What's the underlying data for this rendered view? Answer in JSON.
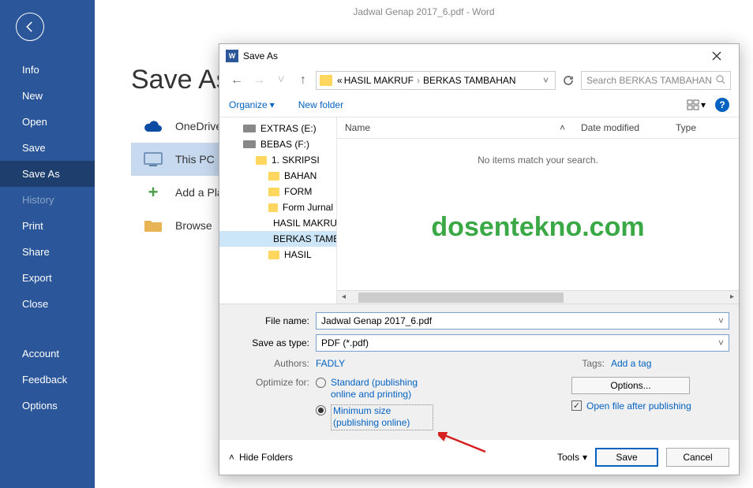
{
  "app": {
    "title": "Jadwal Genap 2017_6.pdf  -  Word"
  },
  "page": {
    "title": "Save As"
  },
  "sidebar": {
    "items": [
      "Info",
      "New",
      "Open",
      "Save",
      "Save As",
      "History",
      "Print",
      "Share",
      "Export",
      "Close"
    ],
    "bottom": [
      "Account",
      "Feedback",
      "Options"
    ]
  },
  "locations": {
    "items": [
      "OneDrive",
      "This PC",
      "Add a Place",
      "Browse"
    ]
  },
  "dialog": {
    "title": "Save As",
    "breadcrumb": {
      "prefix": "«",
      "parts": [
        "HASIL MAKRUF",
        "BERKAS TAMBAHAN"
      ]
    },
    "search_placeholder": "Search BERKAS TAMBAHAN",
    "toolbar": {
      "organize": "Organize",
      "newfolder": "New folder"
    },
    "columns": {
      "name": "Name",
      "date": "Date modified",
      "type": "Type"
    },
    "empty": "No items match your search.",
    "watermark": "dosentekno.com",
    "tree": [
      {
        "label": "EXTRAS (E:)",
        "icon": "drive",
        "indent": 1
      },
      {
        "label": "BEBAS (F:)",
        "icon": "drive",
        "indent": 1
      },
      {
        "label": "1. SKRIPSI",
        "icon": "fold",
        "indent": 2
      },
      {
        "label": "BAHAN",
        "icon": "fold",
        "indent": 3
      },
      {
        "label": "FORM",
        "icon": "fold",
        "indent": 3
      },
      {
        "label": "Form Jurnal",
        "icon": "fold",
        "indent": 3
      },
      {
        "label": "HASIL MAKRUF",
        "icon": "fold",
        "indent": 3
      },
      {
        "label": "BERKAS TAMBAHAN",
        "icon": "fold",
        "indent": 3,
        "selected": true
      },
      {
        "label": "HASIL",
        "icon": "fold",
        "indent": 3
      }
    ],
    "filename_label": "File name:",
    "filename_value": "Jadwal Genap 2017_6.pdf",
    "savetype_label": "Save as type:",
    "savetype_value": "PDF (*.pdf)",
    "authors_label": "Authors:",
    "authors_value": "FADLY",
    "tags_label": "Tags:",
    "tags_value": "Add a tag",
    "optimize_label": "Optimize for:",
    "optimize_options": {
      "standard": "Standard (publishing online and printing)",
      "minimum": "Minimum size (publishing online)"
    },
    "options_btn": "Options...",
    "openafter": "Open file after publishing",
    "hide_folders": "Hide Folders",
    "tools": "Tools",
    "save": "Save",
    "cancel": "Cancel"
  }
}
